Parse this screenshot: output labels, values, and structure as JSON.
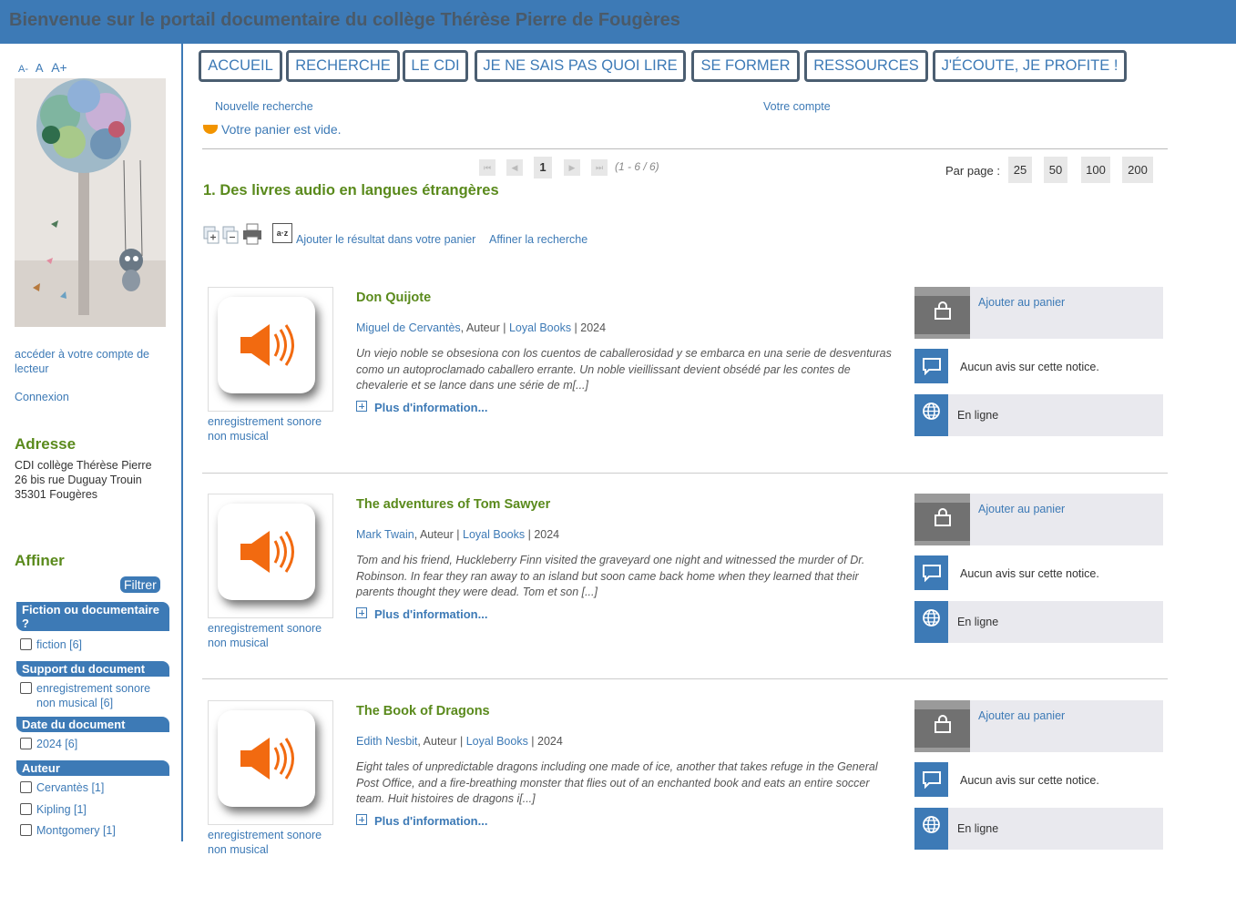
{
  "banner": {
    "title": "Bienvenue sur le portail documentaire du collège Thérèse Pierre de Fougères"
  },
  "left": {
    "font_small": "A-",
    "font_normal": "A",
    "font_large": "A+",
    "account_link": "accéder à votre compte de lecteur",
    "login_link": "Connexion",
    "address_title": "Adresse",
    "address_lines": [
      "CDI collège Thérèse Pierre",
      "26 bis rue Duguay Trouin",
      "35301 Fougères"
    ],
    "affiner_title": "Affiner",
    "filter_button": "Filtrer",
    "facets": [
      {
        "title": "Fiction ou documentaire ?",
        "items": [
          "fiction [6]"
        ]
      },
      {
        "title": "Support du document",
        "items": [
          "enregistrement sonore non musical [6]"
        ]
      },
      {
        "title": "Date du document",
        "items": [
          "2024 [6]"
        ]
      },
      {
        "title": "Auteur",
        "items": [
          "Cervantès [1]",
          "Kipling [1]",
          "Montgomery [1]"
        ]
      }
    ]
  },
  "nav": [
    "ACCUEIL",
    "RECHERCHE",
    "LE CDI",
    "JE NE SAIS PAS QUOI LIRE",
    "SE FORMER",
    "RESSOURCES",
    "J'ÉCOUTE, JE PROFITE !"
  ],
  "search": {
    "new_search": "Nouvelle recherche",
    "your_account": "Votre compte",
    "cart_empty": "Votre panier est vide."
  },
  "pager": {
    "first": "⏮",
    "prev": "◀",
    "current": "1",
    "next": "▶",
    "last": "⏭",
    "range": "(1 - 6 / 6)",
    "per_page_label": "Par page :",
    "per_page_options": [
      "25",
      "50",
      "100",
      "200"
    ]
  },
  "results": {
    "section_title": "1. Des livres audio en langues étrangères",
    "add_result": "Ajouter le résultat dans votre panier",
    "refine": "Affiner la recherche",
    "sort_icon_text": "a·z"
  },
  "records": [
    {
      "title": "Don Quijote",
      "author": "Miguel de Cervantès",
      "role": "Auteur",
      "publisher": "Loyal Books",
      "year": "2024",
      "abstract": "Un viejo noble se obsesiona con los cuentos de caballerosidad y se embarca en una serie de desventuras como un autoproclamado caballero errante. Un noble vieillissant devient obsédé par les contes de chevalerie et se lance dans une série de m[...]",
      "doc_type": "enregistrement sonore non musical",
      "more": "Plus d'information...",
      "cart": "Ajouter au panier",
      "avis": "Aucun avis sur cette notice.",
      "online": "En ligne"
    },
    {
      "title": "The adventures of Tom Sawyer",
      "author": "Mark Twain",
      "role": "Auteur",
      "publisher": "Loyal Books",
      "year": "2024",
      "abstract": "Tom and his friend, Huckleberry Finn visited the graveyard one night and witnessed the murder of Dr. Robinson. In fear they ran away to an island but soon came back home when they learned that their parents thought they were dead. Tom et son [...]",
      "doc_type": "enregistrement sonore non musical",
      "more": "Plus d'information...",
      "cart": "Ajouter au panier",
      "avis": "Aucun avis sur cette notice.",
      "online": "En ligne"
    },
    {
      "title": "The Book of Dragons",
      "author": "Edith Nesbit",
      "role": "Auteur",
      "publisher": "Loyal Books",
      "year": "2024",
      "abstract": "Eight tales of unpredictable dragons including one made of ice, another that takes refuge in the General Post Office, and a fire-breathing monster that flies out of an enchanted book and eats an entire soccer team. Huit histoires de dragons i[...]",
      "doc_type": "enregistrement sonore non musical",
      "more": "Plus d'information...",
      "cart": "Ajouter au panier",
      "avis": "Aucun avis sur cette notice.",
      "online": "En ligne"
    }
  ],
  "colors": {
    "brand": "#3d7ab6",
    "title_green": "#5a8a1c",
    "speaker_orange": "#f26a10"
  }
}
